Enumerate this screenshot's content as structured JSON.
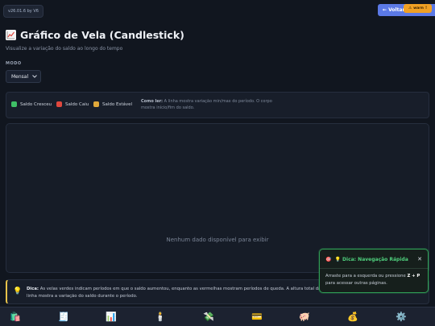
{
  "header": {
    "version": "v26.01.6 by V6",
    "back_label": "← Voltar",
    "warn_label": "warn",
    "warn_count": "!"
  },
  "page": {
    "title_icon": "chart-increasing-icon",
    "title": "Gráfico de Vela (Candlestick)",
    "subtitle": "Visualize a variação do saldo ao longo do tempo"
  },
  "mode": {
    "label": "MODO",
    "selected": "Mensal"
  },
  "legend": {
    "items": [
      {
        "label": "Saldo Cresceu",
        "color": "#3fbf66"
      },
      {
        "label": "Saldo Caiu",
        "color": "#e0483e"
      },
      {
        "label": "Saldo Estável",
        "color": "#e0a83a"
      }
    ],
    "howto_label": "Como ler:",
    "howto_text": "A linha mostra variação min/max do período. O corpo mostra início/fim do saldo."
  },
  "chart": {
    "empty_message": "Nenhum dado disponível para exibir"
  },
  "tip": {
    "label": "Dica:",
    "text": "As velas verdes indicam períodos em que o saldo aumentou, enquanto as vermelhas mostram períodos de queda. A altura total da linha mostra a variação do saldo durante o período."
  },
  "toast": {
    "title": "💡 Dica: Navegação Rápida",
    "close": "✕",
    "body_before": "Arraste para a esquerda ou pressione",
    "shortcut": "Z + P",
    "body_after": "para acessar outras páginas."
  },
  "nav": {
    "items": [
      {
        "icon": "shopping-bags-icon",
        "glyph": "🛍️"
      },
      {
        "icon": "receipt-icon",
        "glyph": "🧾"
      },
      {
        "icon": "bar-chart-icon",
        "glyph": "📊"
      },
      {
        "icon": "candle-icon",
        "glyph": "🕯️"
      },
      {
        "icon": "money-wings-icon",
        "glyph": "💸"
      },
      {
        "icon": "credit-card-icon",
        "glyph": "💳"
      },
      {
        "icon": "piggy-bank-icon",
        "glyph": "🐖"
      },
      {
        "icon": "money-bag-icon",
        "glyph": "💰"
      },
      {
        "icon": "gear-icon",
        "glyph": "⚙️"
      }
    ]
  }
}
